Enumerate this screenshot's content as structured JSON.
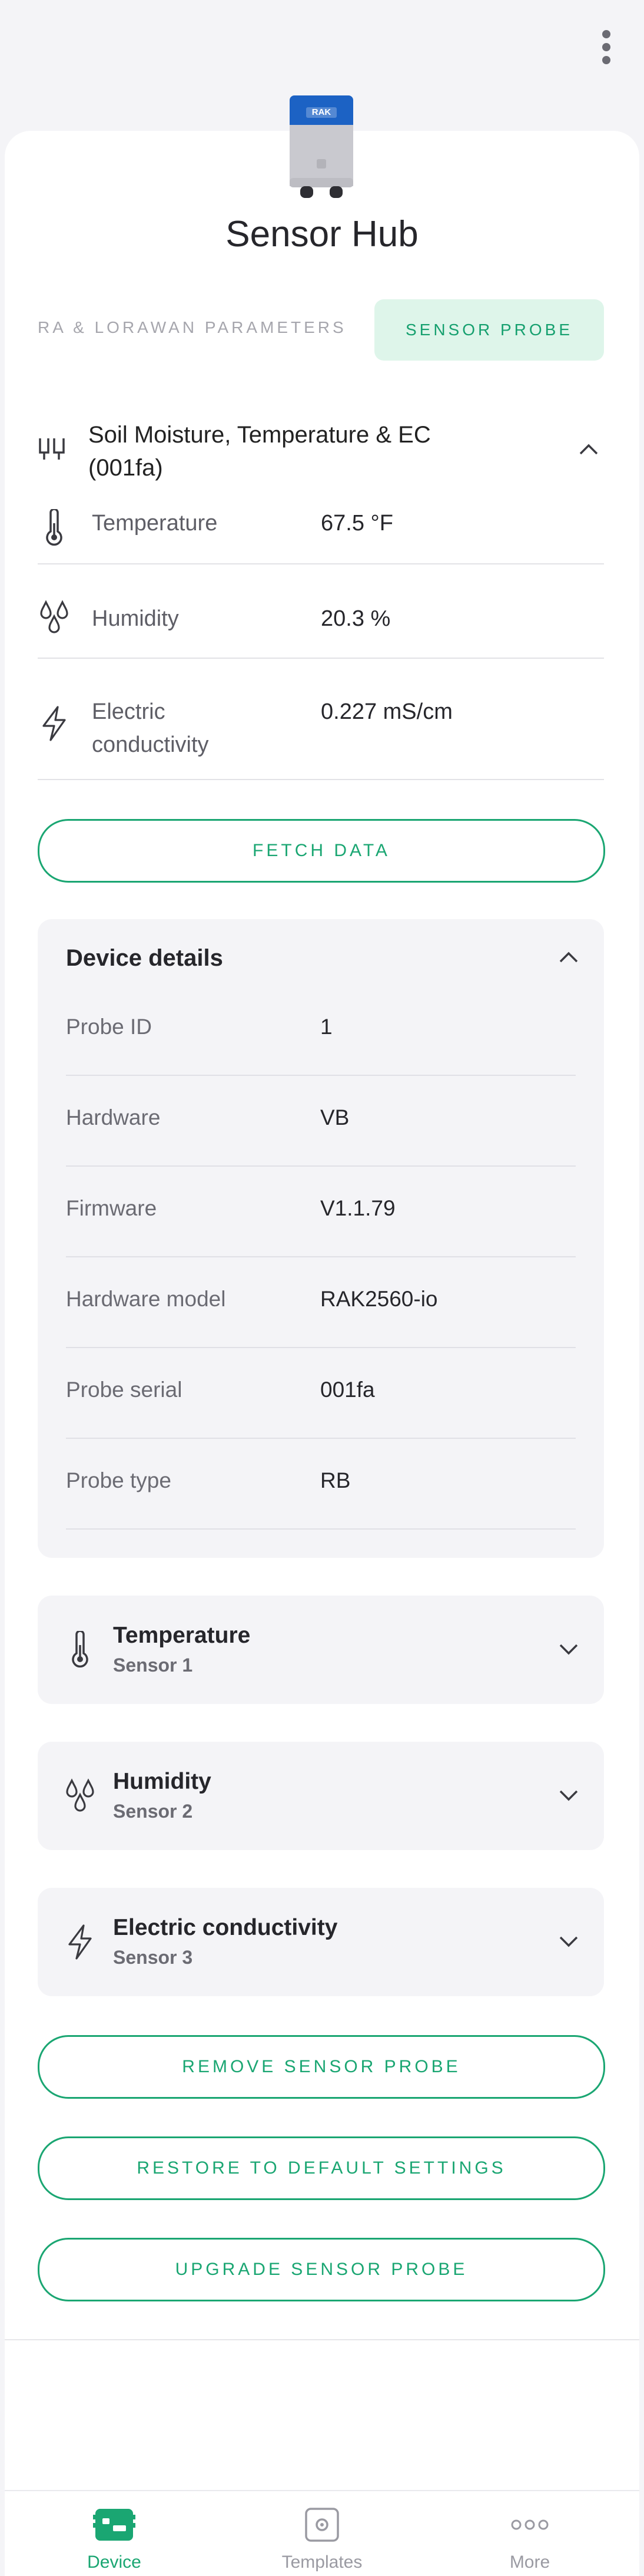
{
  "header": {
    "menu_icon": "more-vert-icon"
  },
  "device": {
    "name": "Sensor Hub",
    "image_label": "RAK"
  },
  "tabs": [
    {
      "label": "RA & LORAWAN PARAMETERS",
      "active": false
    },
    {
      "label": "SENSOR PROBE",
      "active": true
    }
  ],
  "probe": {
    "title_line1": "Soil Moisture, Temperature & EC",
    "title_line2": "(001fa)",
    "icon": "probe-icon",
    "measurements": [
      {
        "label": "Temperature",
        "value": "67.5 °F",
        "icon": "thermometer-icon"
      },
      {
        "label": "Humidity",
        "value": "20.3 %",
        "icon": "droplets-icon"
      },
      {
        "label_line1": "Electric",
        "label_line2": "conductivity",
        "value": "0.227 mS/cm",
        "icon": "lightning-icon"
      }
    ]
  },
  "actions": {
    "fetch": "FETCH DATA",
    "remove": "REMOVE SENSOR PROBE",
    "restore": "RESTORE TO DEFAULT SETTINGS",
    "upgrade": "UPGRADE SENSOR PROBE"
  },
  "details": {
    "title": "Device details",
    "rows": [
      {
        "label": "Probe ID",
        "value": "1"
      },
      {
        "label": "Hardware",
        "value": "VB"
      },
      {
        "label": "Firmware",
        "value": "V1.1.79"
      },
      {
        "label": "Hardware model",
        "value": "RAK2560-io"
      },
      {
        "label": "Probe serial",
        "value": "001fa"
      },
      {
        "label": "Probe type",
        "value": "RB"
      }
    ]
  },
  "sensors": [
    {
      "name": "Temperature",
      "sub": "Sensor 1",
      "icon": "thermometer-icon"
    },
    {
      "name": "Humidity",
      "sub": "Sensor 2",
      "icon": "droplets-icon"
    },
    {
      "name": "Electric conductivity",
      "sub": "Sensor 3",
      "icon": "lightning-icon"
    }
  ],
  "nav": [
    {
      "label": "Device",
      "active": true,
      "icon": "device-icon"
    },
    {
      "label": "Templates",
      "active": false,
      "icon": "templates-icon"
    },
    {
      "label": "More",
      "active": false,
      "icon": "more-horiz-icon"
    }
  ],
  "colors": {
    "accent": "#1aa672",
    "tab_active_bg": "#def5ea",
    "card_bg": "#f4f4f7"
  }
}
